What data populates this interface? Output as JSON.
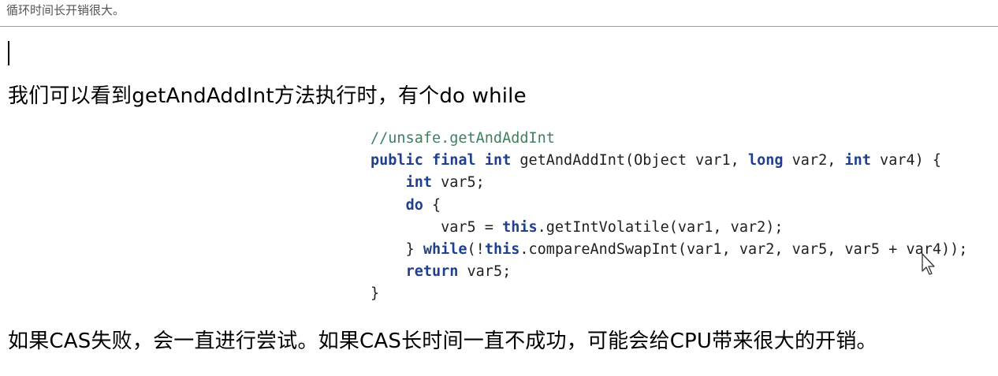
{
  "top_text": "循环时间长开销很大。",
  "paragraph1": "我们可以看到getAndAddInt方法执行时，有个do while",
  "paragraph2": "如果CAS失败，会一直进行尝试。如果CAS长时间一直不成功，可能会给CPU带来很大的开销。",
  "code": {
    "comment": "//unsafe.getAndAddInt",
    "line2_kw1": "public",
    "line2_kw2": "final",
    "line2_kw3": "int",
    "line2_a": " getAndAddInt(Object var1, ",
    "line2_kw4": "long",
    "line2_b": " var2, ",
    "line2_kw5": "int",
    "line2_c": " var4) {",
    "line3_kw": "int",
    "line3_rest": " var5;",
    "line4_kw": "do",
    "line4_rest": " {",
    "line5_a": "var5 = ",
    "line5_kw": "this",
    "line5_b": ".getIntVolatile(var1, var2);",
    "line6_a": "} ",
    "line6_kw1": "while",
    "line6_b": "(!",
    "line6_kw2": "this",
    "line6_c": ".compareAndSwapInt(var1, var2, var5, var5 + var4));",
    "line7_kw": "return",
    "line7_rest": " var5;",
    "line8": "}"
  }
}
